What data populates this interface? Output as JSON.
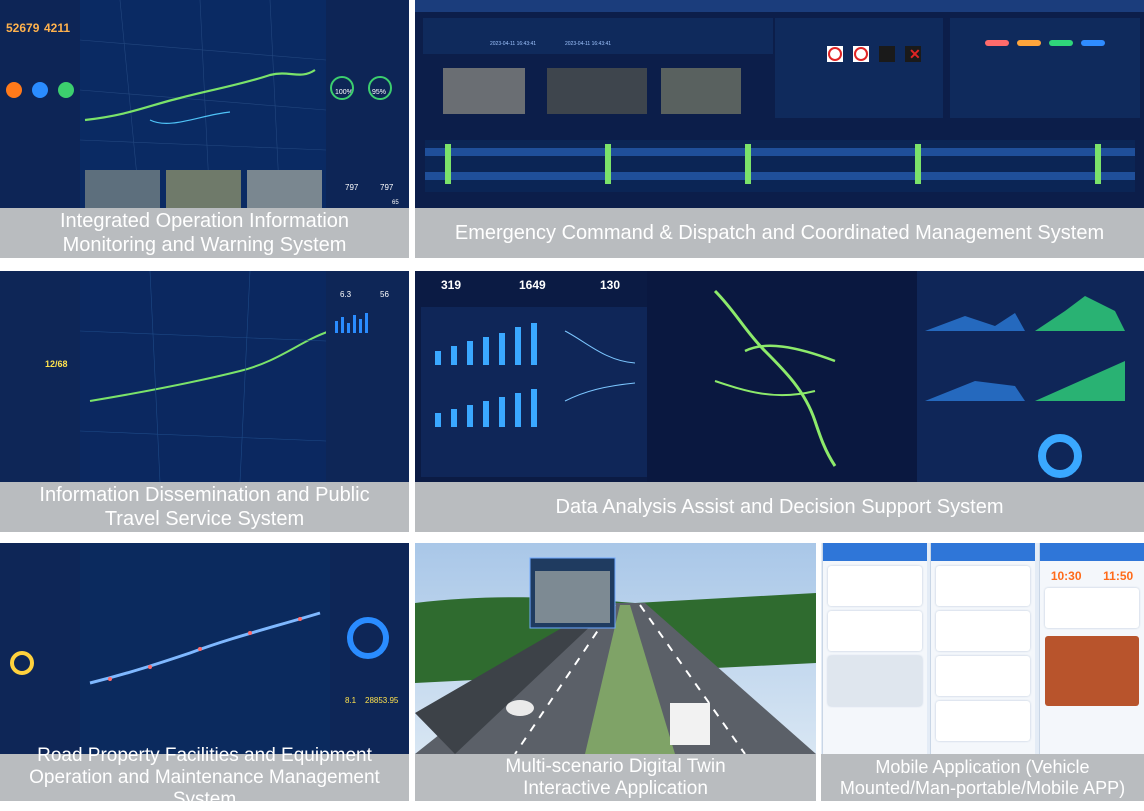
{
  "panels": [
    {
      "id": "integrated-operation",
      "caption": [
        "Integrated Operation Information",
        "Monitoring and Warning System"
      ],
      "kpis": [
        "52679",
        "4211"
      ],
      "gauges": [
        "100%",
        "95%"
      ],
      "counters": [
        "797",
        "797",
        "65"
      ]
    },
    {
      "id": "emergency-command",
      "caption": [
        "Emergency Command & Dispatch and Coordinated Management System"
      ],
      "timestamps": [
        "2023-04-11 16:43:41",
        "2023-04-11 16:43:41"
      ]
    },
    {
      "id": "information-dissemination",
      "caption": [
        "Information Dissemination and Public",
        "Travel Service System"
      ],
      "readouts": [
        "12/68",
        "6.3",
        "56"
      ]
    },
    {
      "id": "data-analysis",
      "caption": [
        "Data Analysis Assist and Decision Support System"
      ],
      "kpis": [
        "319",
        "1649",
        "130"
      ]
    },
    {
      "id": "road-property",
      "caption": [
        "Road Property Facilities and Equipment",
        "Operation and Maintenance Management System"
      ],
      "readouts": [
        "28853.95",
        "8.1"
      ]
    },
    {
      "id": "digital-twin",
      "caption": [
        "Multi-scenario Digital Twin",
        "Interactive Application"
      ]
    },
    {
      "id": "mobile-app",
      "caption": [
        "Mobile Application (Vehicle",
        "Mounted/Man-portable/Mobile APP)"
      ],
      "times": [
        "10:30",
        "11:50"
      ]
    }
  ],
  "colors": {
    "dashboard_bg": "#0b1d4a",
    "accent_blue": "#2a8cff",
    "accent_green": "#7be36a",
    "caption_bg": "#b9bcbf",
    "caption_text": "#ffffff"
  }
}
